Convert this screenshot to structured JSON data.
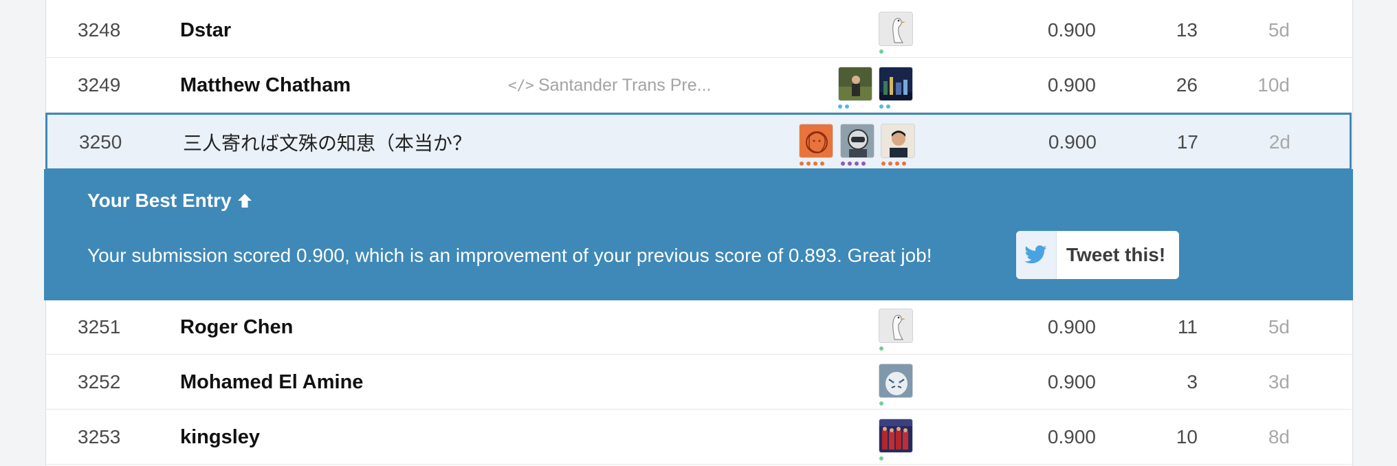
{
  "rows_before": [
    {
      "rank": "3248",
      "name": "Dstar",
      "kernel": "",
      "score": "0.900",
      "entries": "13",
      "last": "5d",
      "avatars": [
        {
          "icon": "goose-avatar",
          "bg": "#e9e9e9",
          "dots": [
            "#6fcf97"
          ]
        }
      ]
    },
    {
      "rank": "3249",
      "name": "Matthew Chatham",
      "kernel": "Santander Trans Pre...",
      "score": "0.900",
      "entries": "26",
      "last": "10d",
      "avatars": [
        {
          "icon": "photo-avatar",
          "bg": "#3b4a2a",
          "dots": [
            "#56b6e8",
            "#56b6e8"
          ]
        },
        {
          "icon": "city-avatar",
          "bg": "#1c2b4c",
          "dots": [
            "#56b6e8",
            "#56b6e8"
          ]
        }
      ]
    }
  ],
  "highlight_row": {
    "rank": "3250",
    "name": "三人寄れば文殊の知恵（本当か？",
    "score": "0.900",
    "entries": "17",
    "last": "2d",
    "avatars": [
      {
        "icon": "lion-avatar",
        "bg": "#e8743b",
        "dots": [
          "#e8743b",
          "#e8743b",
          "#e8743b",
          "#e8743b"
        ]
      },
      {
        "icon": "helmet-avatar",
        "bg": "#6d7d8c",
        "dots": [
          "#8e5bb5",
          "#8e5bb5",
          "#8e5bb5",
          "#8e5bb5"
        ]
      },
      {
        "icon": "face-avatar",
        "bg": "#e8ddd0",
        "dots": [
          "#e8743b",
          "#e8743b",
          "#e8743b",
          "#e8743b"
        ]
      }
    ]
  },
  "banner": {
    "title": "Your Best Entry",
    "title_icon": "arrow-up-icon",
    "message": "Your submission scored 0.900, which is an improvement of your previous score of 0.893. Great job!",
    "tweet_label": "Tweet this!",
    "tweet_icon": "twitter-bird-icon"
  },
  "rows_after": [
    {
      "rank": "3251",
      "name": "Roger Chen",
      "kernel": "",
      "score": "0.900",
      "entries": "11",
      "last": "5d",
      "avatars": [
        {
          "icon": "goose-avatar",
          "bg": "#e9e9e9",
          "dots": [
            "#6fcf97"
          ]
        }
      ]
    },
    {
      "rank": "3252",
      "name": "Mohamed El Amine",
      "kernel": "",
      "score": "0.900",
      "entries": "3",
      "last": "3d",
      "avatars": [
        {
          "icon": "white-tiger-avatar",
          "bg": "#9fb4c4",
          "dots": [
            "#6fcf97"
          ]
        }
      ]
    },
    {
      "rank": "3253",
      "name": "kingsley",
      "kernel": "",
      "score": "0.900",
      "entries": "10",
      "last": "8d",
      "avatars": [
        {
          "icon": "team-avatar",
          "bg": "#2a2f63",
          "dots": [
            "#6fcf97"
          ]
        }
      ]
    }
  ],
  "colors": {
    "accent": "#3e89b8",
    "highlight_bg": "#eaf1f8",
    "twitter": "#4aa3e0"
  }
}
